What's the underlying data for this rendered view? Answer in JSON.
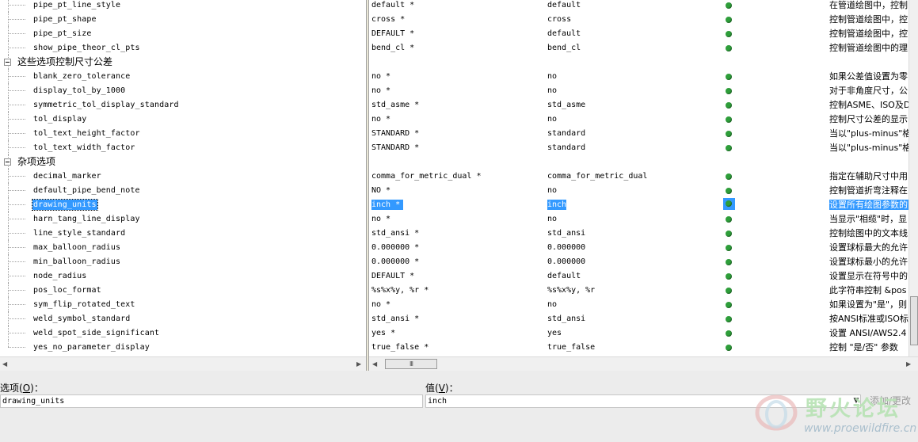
{
  "tree": {
    "rows": [
      {
        "type": "child",
        "name": "pipe_pt_line_style"
      },
      {
        "type": "child",
        "name": "pipe_pt_shape"
      },
      {
        "type": "child",
        "name": "pipe_pt_size"
      },
      {
        "type": "child",
        "name": "show_pipe_theor_cl_pts"
      },
      {
        "type": "group",
        "name": "这些选项控制尺寸公差"
      },
      {
        "type": "child",
        "name": "blank_zero_tolerance"
      },
      {
        "type": "child",
        "name": "display_tol_by_1000"
      },
      {
        "type": "child",
        "name": "symmetric_tol_display_standard"
      },
      {
        "type": "child",
        "name": "tol_display"
      },
      {
        "type": "child",
        "name": "tol_text_height_factor"
      },
      {
        "type": "child",
        "name": "tol_text_width_factor"
      },
      {
        "type": "group",
        "name": "杂项选项"
      },
      {
        "type": "child",
        "name": "decimal_marker"
      },
      {
        "type": "child",
        "name": "default_pipe_bend_note"
      },
      {
        "type": "child",
        "name": "drawing_units",
        "selected": true
      },
      {
        "type": "child",
        "name": "harn_tang_line_display"
      },
      {
        "type": "child",
        "name": "line_style_standard"
      },
      {
        "type": "child",
        "name": "max_balloon_radius"
      },
      {
        "type": "child",
        "name": "min_balloon_radius"
      },
      {
        "type": "child",
        "name": "node_radius"
      },
      {
        "type": "child",
        "name": "pos_loc_format"
      },
      {
        "type": "child",
        "name": "sym_flip_rotated_text"
      },
      {
        "type": "child",
        "name": "weld_symbol_standard"
      },
      {
        "type": "child",
        "name": "weld_spot_side_significant"
      },
      {
        "type": "child",
        "name": "yes_no_parameter_display"
      }
    ]
  },
  "grid": {
    "rows": [
      {
        "value": "default *",
        "default": "default",
        "status": "green",
        "desc": "在管道绘图中，控制"
      },
      {
        "value": "cross *",
        "default": "cross",
        "status": "green",
        "desc": "控制管道绘图中，控"
      },
      {
        "value": "DEFAULT *",
        "default": "default",
        "status": "green",
        "desc": "控制管道绘图中，控"
      },
      {
        "value": "bend_cl *",
        "default": "bend_cl",
        "status": "green",
        "desc": "控制管道绘图中的理"
      },
      null,
      {
        "value": "no *",
        "default": "no",
        "status": "green",
        "desc": "如果公差值设置为零"
      },
      {
        "value": "no *",
        "default": "no",
        "status": "green",
        "desc": "对于非角度尺寸，公"
      },
      {
        "value": "std_asme *",
        "default": "std_asme",
        "status": "green",
        "desc": "控制ASME、ISO及DIN"
      },
      {
        "value": "no *",
        "default": "no",
        "status": "green",
        "desc": "控制尺寸公差的显示"
      },
      {
        "value": "STANDARD *",
        "default": "standard",
        "status": "green",
        "desc": "当以\"plus-minus\"格"
      },
      {
        "value": "STANDARD *",
        "default": "standard",
        "status": "green",
        "desc": "当以\"plus-minus\"格"
      },
      null,
      {
        "value": "comma_for_metric_dual *",
        "default": "comma_for_metric_dual",
        "status": "green",
        "desc": "指定在辅助尺寸中用"
      },
      {
        "value": "NO *",
        "default": "no",
        "status": "green",
        "desc": "控制管道折弯注释在"
      },
      {
        "value": "inch *",
        "default": "inch",
        "status": "green",
        "desc": "设置所有绘图参数的",
        "selected": true
      },
      {
        "value": "no *",
        "default": "no",
        "status": "green",
        "desc": "当显示\"相缆\"时，显"
      },
      {
        "value": "std_ansi *",
        "default": "std_ansi",
        "status": "green",
        "desc": "控制绘图中的文本线"
      },
      {
        "value": "0.000000 *",
        "default": "0.000000",
        "status": "green",
        "desc": "设置球标最大的允许"
      },
      {
        "value": "0.000000 *",
        "default": "0.000000",
        "status": "green",
        "desc": "设置球标最小的允许"
      },
      {
        "value": "DEFAULT *",
        "default": "default",
        "status": "green",
        "desc": "设置显示在符号中的"
      },
      {
        "value": "%s%x%y, %r *",
        "default": "%s%x%y, %r",
        "status": "green",
        "desc": "此字符串控制 &pos"
      },
      {
        "value": "no *",
        "default": "no",
        "status": "green",
        "desc": "如果设置为\"是\"，则"
      },
      {
        "value": "std_ansi *",
        "default": "std_ansi",
        "status": "green",
        "desc": "按ANSI标准或ISO标准"
      },
      {
        "value": "yes *",
        "default": "yes",
        "status": "green",
        "desc": "设置 ANSI/AWS2.4"
      },
      {
        "value": "true_false *",
        "default": "true_false",
        "status": "green",
        "desc": "控制 \"是/否\" 参数"
      }
    ]
  },
  "scroll": {
    "hscroll_thumb_grip": "III",
    "left_arrow": "◀",
    "right_arrow": "▶"
  },
  "editor": {
    "option_label": "选项",
    "option_hotkey": "O",
    "value_label": "值",
    "value_hotkey": "V",
    "option_value": "drawing_units",
    "value_value": "inch",
    "dropdown_glyph": "▼",
    "add_change_label": "添加/更改"
  },
  "watermark": {
    "title": "野火论坛",
    "url": "www.proewildfire.cn"
  },
  "colors": {
    "selection": "#3399ff",
    "status_green": "#2e9e3a"
  }
}
